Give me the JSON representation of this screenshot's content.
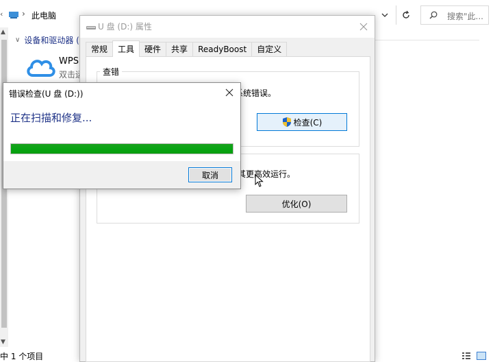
{
  "explorer": {
    "address": "此电脑",
    "search_placeholder": "搜索\"此...",
    "group_header": "设备和驱动器 (",
    "wps_title": "WPS",
    "wps_sub": "双击运",
    "status": "中 1 个项目",
    "icons": [
      "chevron-left-icon",
      "pc-icon",
      "breadcrumb-separator-icon",
      "chevron-down-icon",
      "refresh-icon",
      "search-icon",
      "wps-cloud-icon",
      "details-view-icon",
      "large-icons-view-icon"
    ]
  },
  "properties": {
    "title": "U 盘 (D:) 属性",
    "tabs": [
      {
        "label": "常规"
      },
      {
        "label": "工具"
      },
      {
        "label": "硬件"
      },
      {
        "label": "共享"
      },
      {
        "label": "ReadyBoost"
      },
      {
        "label": "自定义"
      }
    ],
    "active_tab": "工具",
    "error_check_group": "查错",
    "error_check_text": "系统错误。",
    "check_button": "检查(C)",
    "optimize_text": "其更高效运行。",
    "optimize_button": "优化(O)"
  },
  "error_dialog": {
    "title": "错误检查(U 盘 (D:))",
    "status": "正在扫描和修复...",
    "progress_percent": 100,
    "cancel_button": "取消"
  },
  "colors": {
    "accent": "#0078d7",
    "progress": "#06b025",
    "status_text": "#1e3287"
  }
}
